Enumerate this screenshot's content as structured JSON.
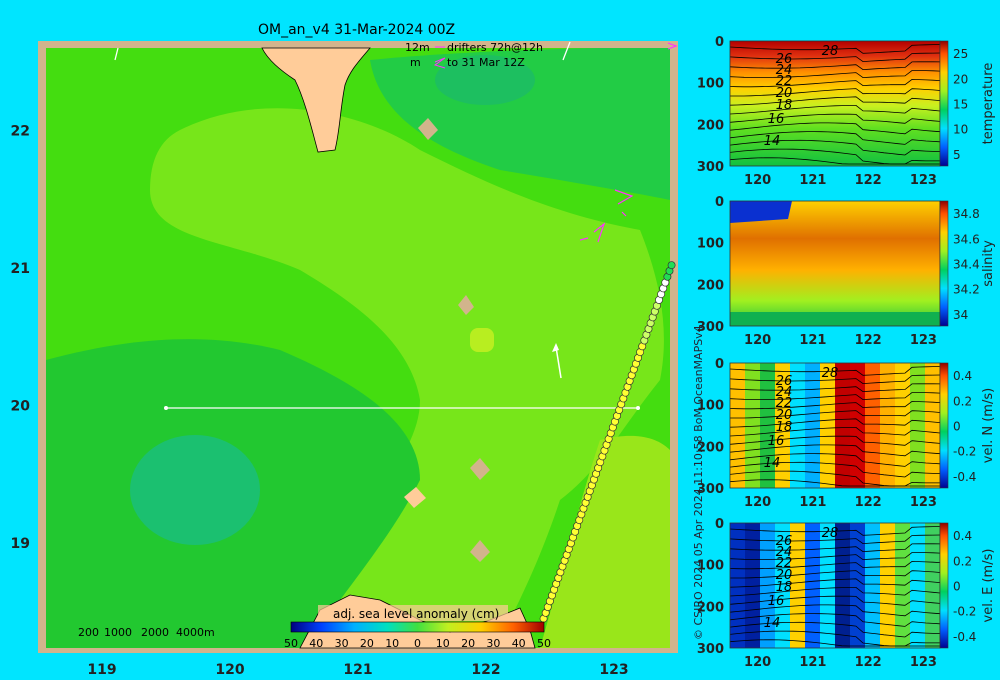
{
  "header": {
    "title": "OM_an_v4  31-Mar-2024 00Z",
    "drifters_line1": "12m",
    "drifters_line1b": "drifters 72h@12h",
    "drifters_line2": "m",
    "drifters_line2b": "to 31 Mar 12Z"
  },
  "side_credit": "© CSIRO 2024   05 Apr 2024 11:10:58 BoM OceanMAPSv4",
  "colors": {
    "background": "#00e5ff",
    "land": "#ffcc99",
    "frame": "#d2b48c",
    "drifter_arrow": "#ff33ff"
  },
  "chart_data": [
    {
      "type": "heatmap",
      "name_text": "adj. sea level anomaly (cm)",
      "title": "OM_an_v4  31-Mar-2024 00Z",
      "xlim": [
        118.5,
        123.5
      ],
      "ylim": [
        18.2,
        22.65
      ],
      "x_ticks": [
        119,
        120,
        121,
        122,
        123
      ],
      "y_ticks": [
        19,
        20,
        21,
        22
      ],
      "bathymetry_labels": [
        "200",
        "1000",
        "2000",
        "4000m"
      ],
      "colorbar": {
        "label": "adj. sea level anomaly (cm)",
        "ticks": [
          "50",
          "40",
          "30",
          "20",
          "10",
          "0",
          "10",
          "20",
          "30",
          "40",
          "50"
        ],
        "range": [
          -50,
          50
        ]
      },
      "section_line": {
        "lat": 20,
        "lon_start": 119.5,
        "lon_end": 123.2
      },
      "ssh_regions_cm": [
        {
          "level": 8,
          "desc": "background"
        },
        {
          "level": 4,
          "desc": "western lower band"
        },
        {
          "level": 2,
          "desc": "eddy core near 119.4E 19.4N"
        },
        {
          "level": 12,
          "desc": "central tongue"
        },
        {
          "level": 20,
          "desc": "patch near 121.9E 20.5N"
        }
      ],
      "drifter_track": {
        "lon_start": 122.45,
        "lat_start": 18.45,
        "lon_end": 123.45,
        "lat_end": 21.02
      }
    },
    {
      "type": "heatmap",
      "variable": "temperature",
      "xlabel_ticks": [
        120,
        121,
        122,
        123
      ],
      "ylabel_ticks": [
        0,
        100,
        200,
        300
      ],
      "colorbar_ticks": [
        5,
        10,
        15,
        20,
        25
      ],
      "contour_labels": [
        "28",
        "26",
        "24",
        "22",
        "20",
        "18",
        "16",
        "14"
      ],
      "units_label": "temperature"
    },
    {
      "type": "heatmap",
      "variable": "salinity",
      "xlabel_ticks": [
        120,
        121,
        122,
        123
      ],
      "ylabel_ticks": [
        0,
        100,
        200,
        300
      ],
      "colorbar_ticks": [
        34.0,
        34.2,
        34.4,
        34.6,
        34.8
      ],
      "colorbar_tick_labels": [
        "34",
        "34.2",
        "34.4",
        "34.6",
        "34.8"
      ],
      "units_label": "salinity"
    },
    {
      "type": "heatmap",
      "variable": "vel. N (m/s)",
      "xlabel_ticks": [
        120,
        121,
        122,
        123
      ],
      "ylabel_ticks": [
        0,
        100,
        200,
        300
      ],
      "colorbar_ticks": [
        0.4,
        0.2,
        0,
        -0.2,
        -0.4
      ],
      "colorbar_tick_labels": [
        "0.4",
        "0.2",
        "0",
        "-0.2",
        "-0.4"
      ],
      "contour_labels": [
        "28",
        "26",
        "24",
        "22",
        "20",
        "18",
        "16",
        "14"
      ],
      "units_label": "vel. N (m/s)"
    },
    {
      "type": "heatmap",
      "variable": "vel. E (m/s)",
      "xlabel_ticks": [
        120,
        121,
        122,
        123
      ],
      "ylabel_ticks": [
        0,
        100,
        200,
        300
      ],
      "colorbar_ticks": [
        0.4,
        0.2,
        0,
        -0.2,
        -0.4
      ],
      "colorbar_tick_labels": [
        "0.4",
        "0.2",
        "0",
        "-0.2",
        "-0.4"
      ],
      "contour_labels": [
        "28",
        "26",
        "24",
        "22",
        "20",
        "18",
        "16",
        "14"
      ],
      "units_label": "vel. E (m/s)"
    }
  ]
}
